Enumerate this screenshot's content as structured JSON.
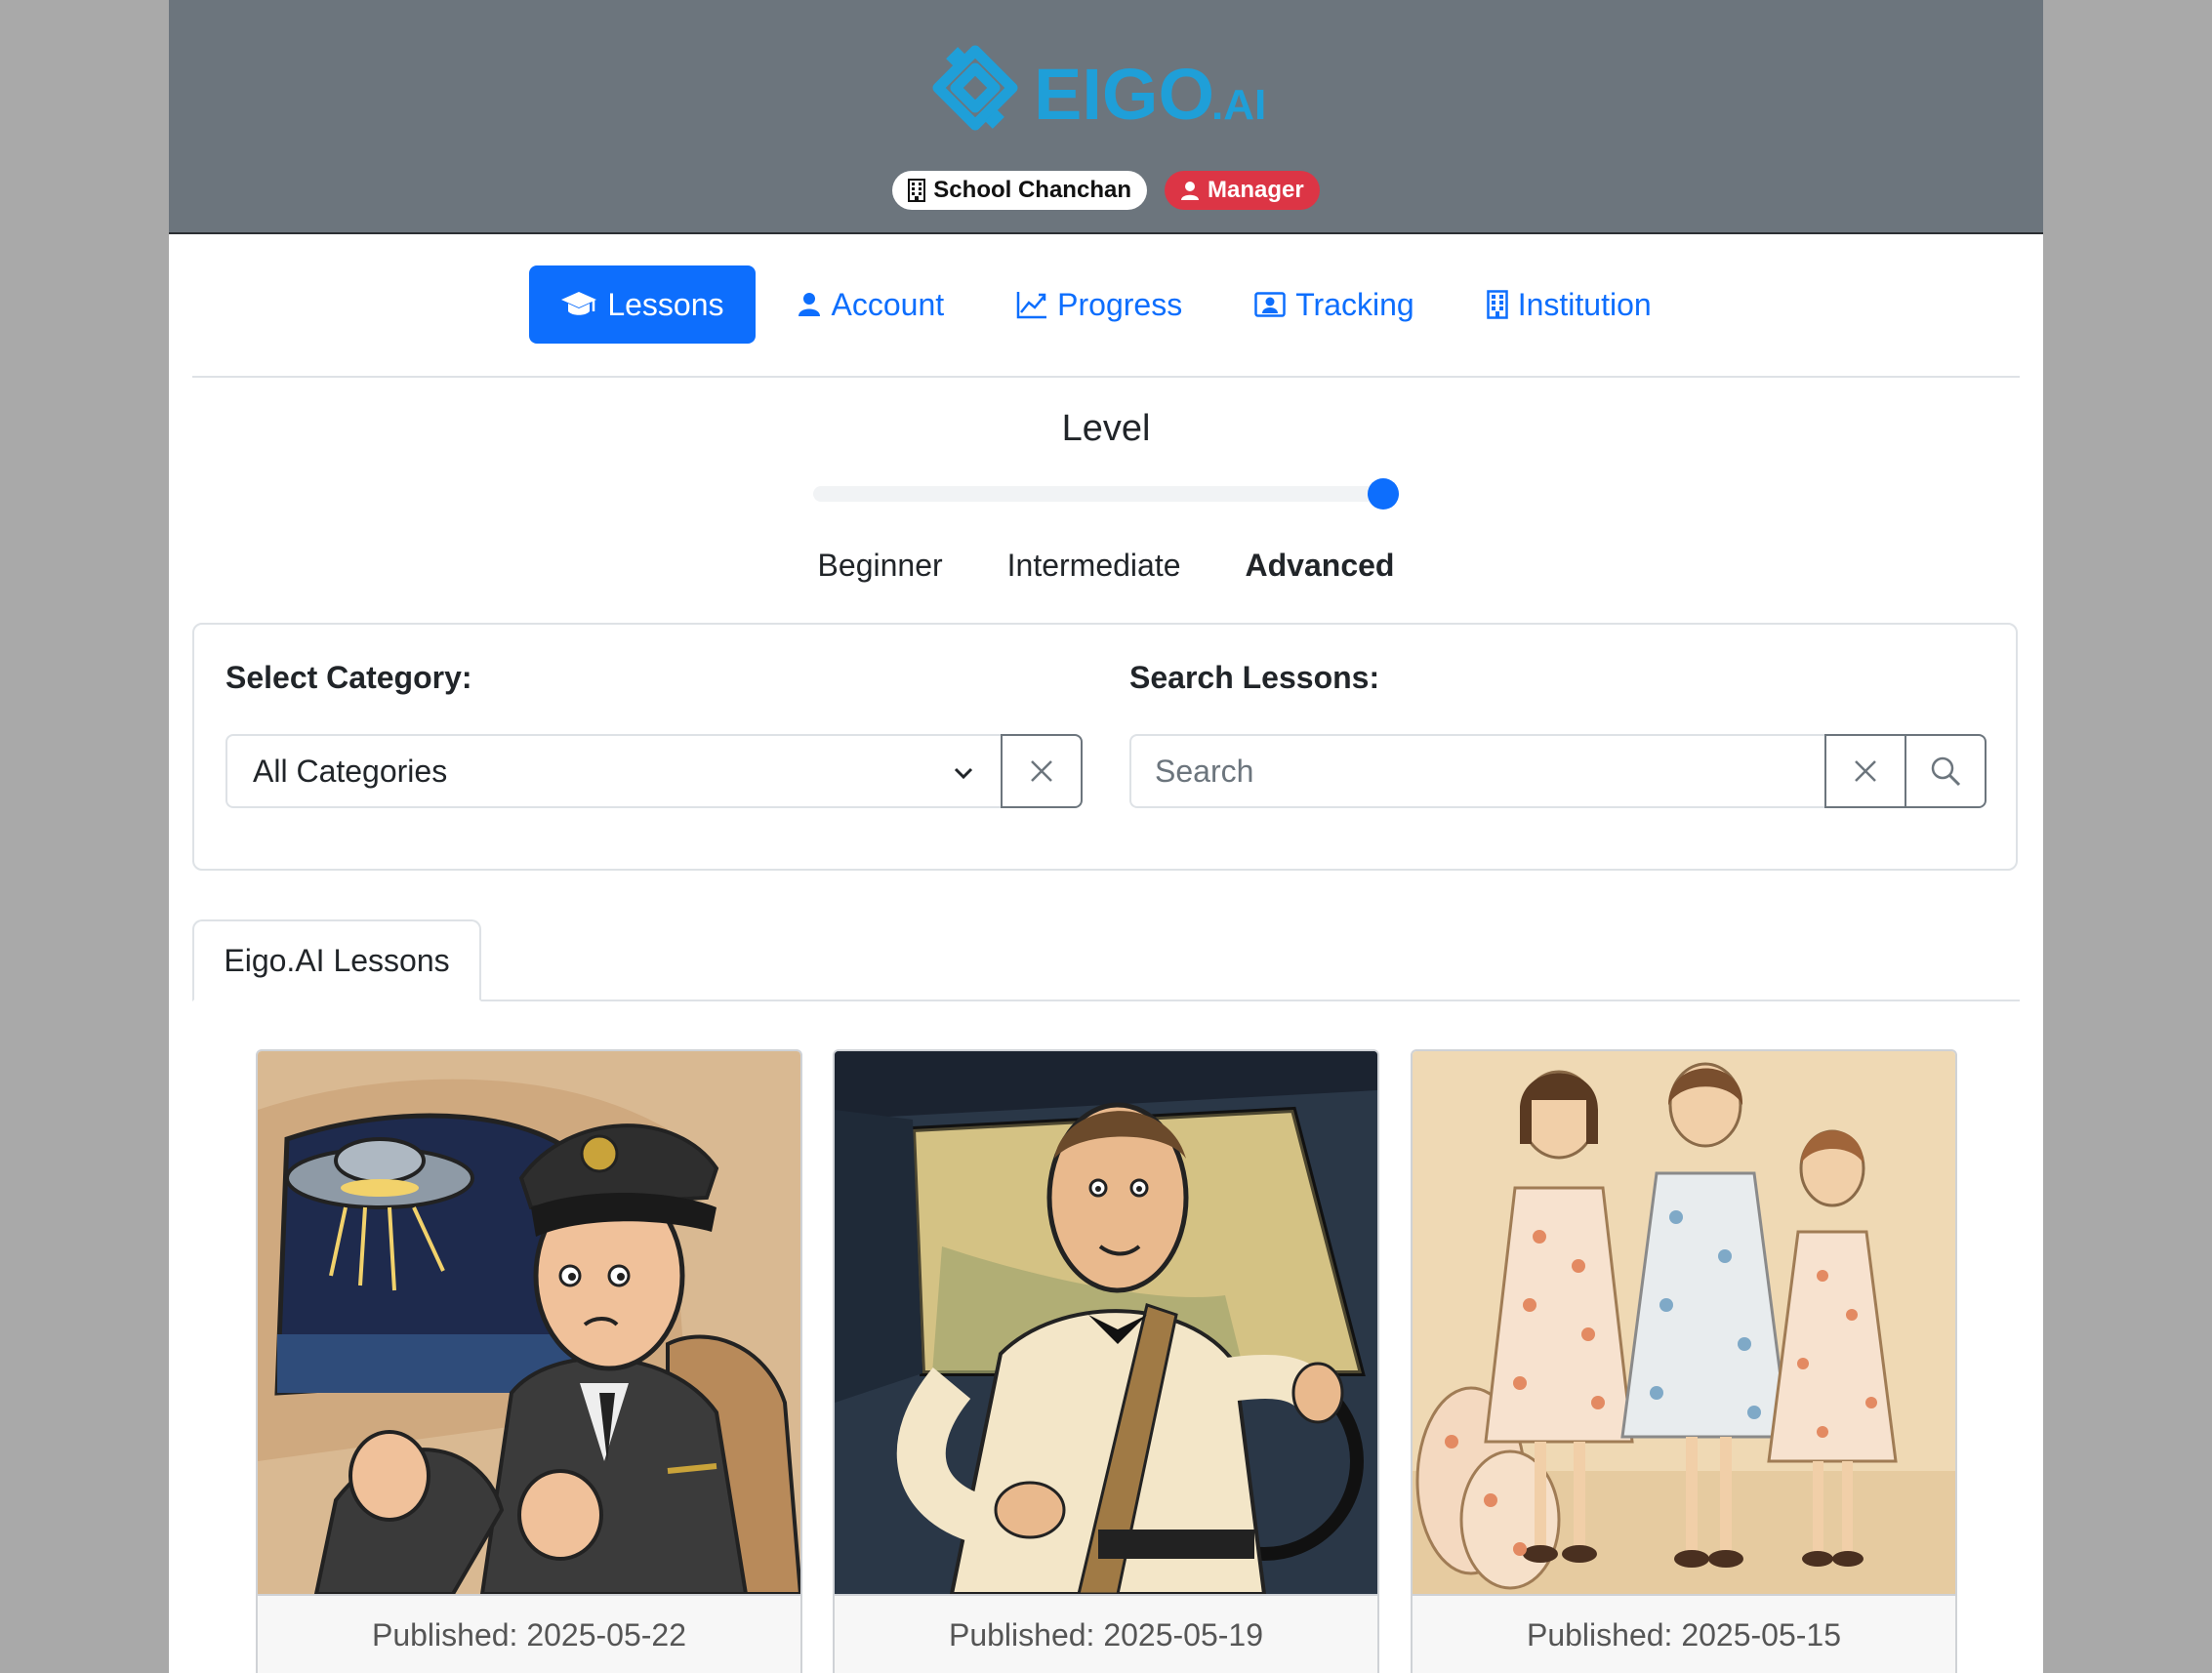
{
  "brand": {
    "logo_text": "EIGO",
    "logo_suffix": ".AI",
    "accent": "#1f9fd8"
  },
  "badges": {
    "school": {
      "label": "School Chanchan",
      "icon": "building-icon"
    },
    "role": {
      "label": "Manager",
      "icon": "person-icon",
      "color": "#dc3545"
    }
  },
  "nav": {
    "items": [
      {
        "label": "Lessons",
        "icon": "graduation-cap-icon",
        "active": true
      },
      {
        "label": "Account",
        "icon": "person-icon"
      },
      {
        "label": "Progress",
        "icon": "chart-line-icon"
      },
      {
        "label": "Tracking",
        "icon": "person-card-icon"
      },
      {
        "label": "Institution",
        "icon": "building-icon"
      }
    ],
    "active_color": "#0d6efd"
  },
  "level": {
    "title": "Level",
    "options": [
      "Beginner",
      "Intermediate",
      "Advanced"
    ],
    "selected": "Advanced",
    "slider_fraction": 1.0
  },
  "filters": {
    "category_label": "Select Category:",
    "category_value": "All Categories",
    "search_label": "Search Lessons:",
    "search_placeholder": "Search"
  },
  "tabs": {
    "active": "Eigo.AI Lessons"
  },
  "lessons": [
    {
      "published": "Published: 2025-05-22",
      "image": "pilot-ufo-illustration"
    },
    {
      "published": "Published: 2025-05-19",
      "image": "man-driving-car-illustration"
    },
    {
      "published": "Published: 2025-05-15",
      "image": "three-girls-floral-dresses-illustration"
    }
  ]
}
